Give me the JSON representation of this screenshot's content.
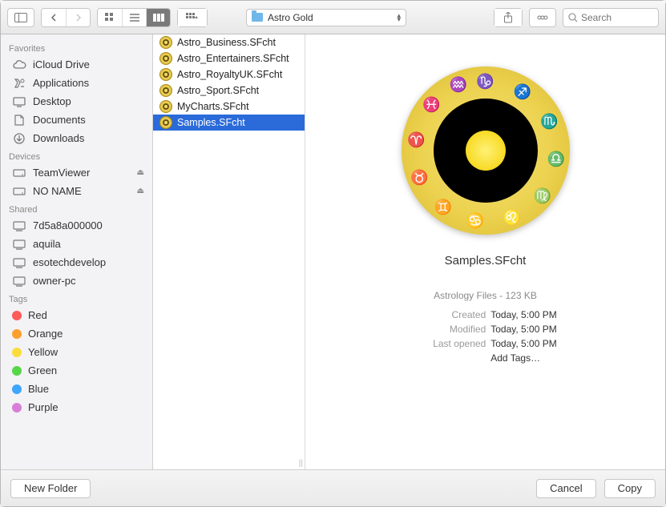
{
  "toolbar": {
    "folder_name": "Astro Gold",
    "search_placeholder": "Search"
  },
  "sidebar": {
    "sections": [
      {
        "header": "Favorites",
        "items": [
          {
            "label": "iCloud Drive",
            "icon": "cloud"
          },
          {
            "label": "Applications",
            "icon": "apps"
          },
          {
            "label": "Desktop",
            "icon": "desktop"
          },
          {
            "label": "Documents",
            "icon": "documents"
          },
          {
            "label": "Downloads",
            "icon": "downloads"
          }
        ]
      },
      {
        "header": "Devices",
        "items": [
          {
            "label": "TeamViewer",
            "icon": "disk",
            "eject": true
          },
          {
            "label": "NO NAME",
            "icon": "disk",
            "eject": true
          }
        ]
      },
      {
        "header": "Shared",
        "items": [
          {
            "label": "7d5a8a000000",
            "icon": "host"
          },
          {
            "label": "aquila",
            "icon": "host"
          },
          {
            "label": "esotechdevelop",
            "icon": "host"
          },
          {
            "label": "owner-pc",
            "icon": "host"
          }
        ]
      },
      {
        "header": "Tags",
        "items": [
          {
            "label": "Red",
            "color": "#fc5b57"
          },
          {
            "label": "Orange",
            "color": "#fc9f2c"
          },
          {
            "label": "Yellow",
            "color": "#fadd3c"
          },
          {
            "label": "Green",
            "color": "#57d64a"
          },
          {
            "label": "Blue",
            "color": "#3ea6ff"
          },
          {
            "label": "Purple",
            "color": "#d87ed8"
          }
        ]
      }
    ]
  },
  "files": [
    {
      "name": "Astro_Business.SFcht"
    },
    {
      "name": "Astro_Entertainers.SFcht"
    },
    {
      "name": "Astro_RoyaltyUK.SFcht"
    },
    {
      "name": "Astro_Sport.SFcht"
    },
    {
      "name": "MyCharts.SFcht"
    },
    {
      "name": "Samples.SFcht",
      "selected": true
    }
  ],
  "preview": {
    "title": "Samples.SFcht",
    "subtitle": "Astrology Files - 123 KB",
    "meta": [
      {
        "label": "Created",
        "value": "Today, 5:00 PM"
      },
      {
        "label": "Modified",
        "value": "Today, 5:00 PM"
      },
      {
        "label": "Last opened",
        "value": "Today, 5:00 PM"
      }
    ],
    "add_tags": "Add Tags…"
  },
  "footer": {
    "new_folder": "New Folder",
    "cancel": "Cancel",
    "confirm": "Copy"
  }
}
